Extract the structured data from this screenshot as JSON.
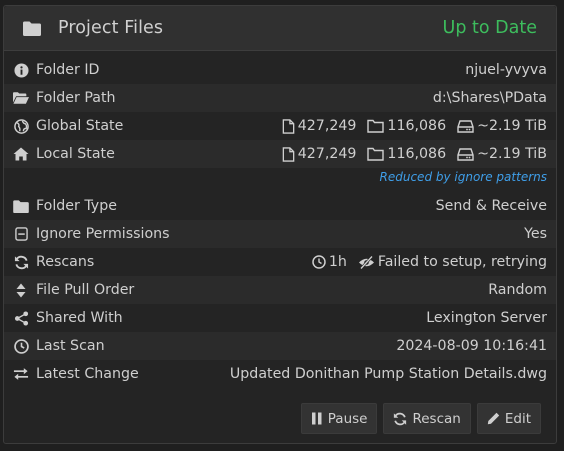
{
  "header": {
    "icon": "folder-icon",
    "title": "Project Files",
    "status": "Up to Date",
    "status_color": "#3dbd5d"
  },
  "rows": {
    "folder_id": {
      "icon": "info-circle-icon",
      "label": "Folder ID",
      "value": "njuel-yvyva"
    },
    "folder_path": {
      "icon": "folder-open-icon",
      "label": "Folder Path",
      "value": "d:\\Shares\\PData"
    },
    "global_state": {
      "icon": "globe-icon",
      "label": "Global State",
      "files": "427,249",
      "directories": "116,086",
      "size": "~2.19 TiB"
    },
    "local_state": {
      "icon": "home-icon",
      "label": "Local State",
      "files": "427,249",
      "directories": "116,086",
      "size": "~2.19 TiB",
      "note": "Reduced by ignore patterns"
    },
    "folder_type": {
      "icon": "folder-icon",
      "label": "Folder Type",
      "value": "Send & Receive"
    },
    "ignore_permissions": {
      "icon": "minus-square-icon",
      "label": "Ignore Permissions",
      "value": "Yes"
    },
    "rescans": {
      "icon": "refresh-icon",
      "label": "Rescans",
      "interval": "1h",
      "watcher": "Failed to setup, retrying"
    },
    "file_pull_order": {
      "icon": "sort-icon",
      "label": "File Pull Order",
      "value": "Random"
    },
    "shared_with": {
      "icon": "share-alt-icon",
      "label": "Shared With",
      "value": "Lexington Server"
    },
    "last_scan": {
      "icon": "clock-icon",
      "label": "Last Scan",
      "value": "2024-08-09 10:16:41"
    },
    "latest_change": {
      "icon": "exchange-icon",
      "label": "Latest Change",
      "value": "Updated Donithan Pump Station Details.dwg"
    }
  },
  "buttons": {
    "pause": {
      "icon": "pause-icon",
      "label": "Pause"
    },
    "rescan": {
      "icon": "refresh-icon",
      "label": "Rescan"
    },
    "edit": {
      "icon": "pencil-icon",
      "label": "Edit"
    }
  },
  "colors": {
    "accent_link": "#3f9ee8",
    "background": "#242424",
    "header": "#303030"
  }
}
